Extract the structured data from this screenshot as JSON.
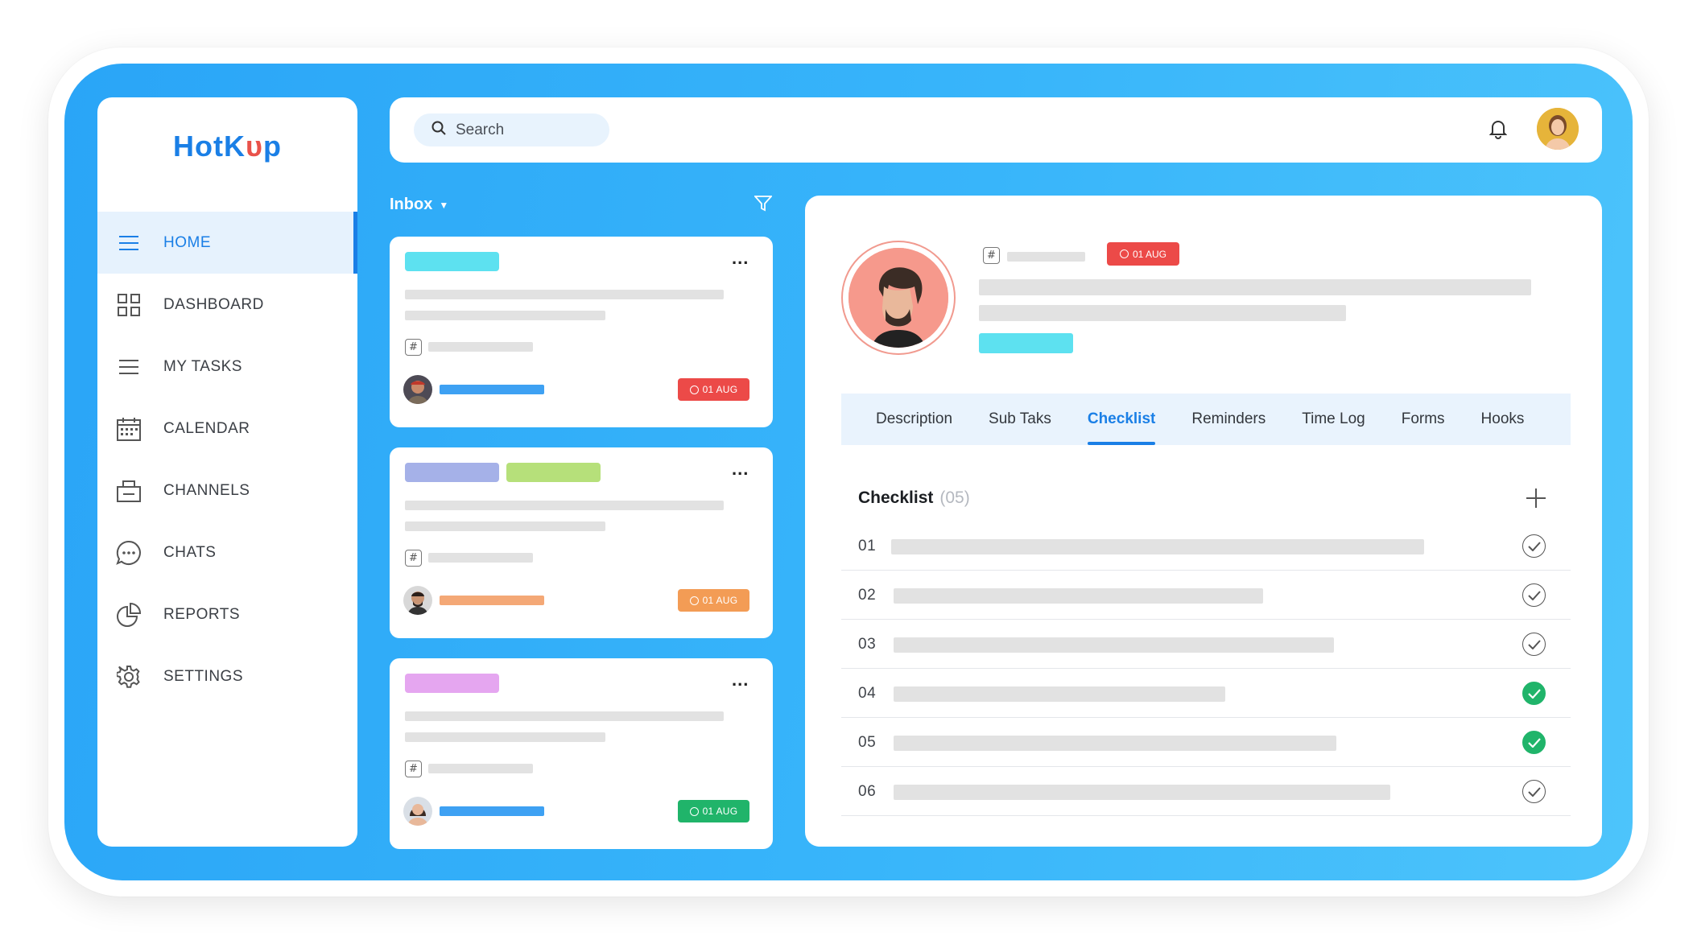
{
  "brand": {
    "name_part1": "HotK",
    "name_cup": "ᴜ",
    "name_part2": "p"
  },
  "sidebar": {
    "items": [
      {
        "label": "HOME",
        "icon": "menu-icon",
        "active": true
      },
      {
        "label": "DASHBOARD",
        "icon": "grid-icon",
        "active": false
      },
      {
        "label": "MY TASKS",
        "icon": "list-icon",
        "active": false
      },
      {
        "label": "CALENDAR",
        "icon": "calendar-icon",
        "active": false
      },
      {
        "label": "CHANNELS",
        "icon": "channels-icon",
        "active": false
      },
      {
        "label": "CHATS",
        "icon": "chat-icon",
        "active": false
      },
      {
        "label": "REPORTS",
        "icon": "pie-chart-icon",
        "active": false
      },
      {
        "label": "SETTINGS",
        "icon": "gear-icon",
        "active": false
      }
    ]
  },
  "search": {
    "placeholder": "Search"
  },
  "inbox": {
    "title": "Inbox",
    "cards": [
      {
        "more": "...",
        "date": "01 AUG",
        "date_color": "#ec4a48",
        "bar_color": "#3ea1f3",
        "tag_colors": [
          "#5de1f0"
        ]
      },
      {
        "more": "...",
        "date": "01 AUG",
        "date_color": "#f39c55",
        "bar_color": "#f4a876",
        "tag_colors": [
          "#a5b1e8",
          "#b6e07a"
        ]
      },
      {
        "more": "...",
        "date": "01 AUG",
        "date_color": "#20b46a",
        "bar_color": "#3ea1f3",
        "tag_colors": [
          "#e5a6f0"
        ]
      }
    ]
  },
  "detail": {
    "date": "01 AUG",
    "tabs": [
      "Description",
      "Sub Taks",
      "Checklist",
      "Reminders",
      "Time Log",
      "Forms",
      "Hooks"
    ],
    "active_tab": "Checklist",
    "checklist": {
      "title": "Checklist",
      "count": "(05)",
      "items": [
        {
          "num": "01",
          "done": false
        },
        {
          "num": "02",
          "done": false
        },
        {
          "num": "03",
          "done": false
        },
        {
          "num": "04",
          "done": true
        },
        {
          "num": "05",
          "done": true
        },
        {
          "num": "06",
          "done": false
        }
      ]
    }
  },
  "colors": {
    "accent": "#1a7fe6",
    "done": "#20b46a",
    "overdue": "#ec4a48"
  }
}
